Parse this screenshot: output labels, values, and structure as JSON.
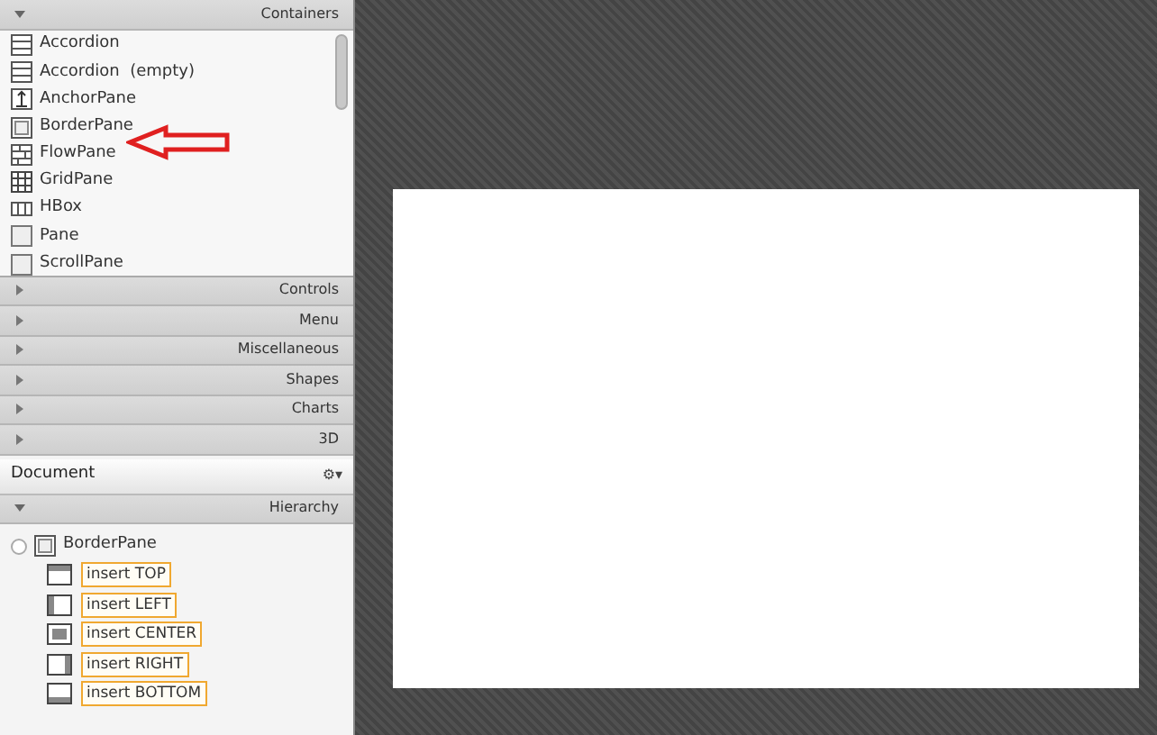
{
  "library": {
    "sections": [
      {
        "title": "Containers",
        "expanded": true,
        "items": [
          {
            "label": "Accordion",
            "kind": "accordion"
          },
          {
            "label": "Accordion  (empty)",
            "kind": "accordion"
          },
          {
            "label": "AnchorPane",
            "kind": "anchor"
          },
          {
            "label": "BorderPane",
            "kind": "border"
          },
          {
            "label": "FlowPane",
            "kind": "flow"
          },
          {
            "label": "GridPane",
            "kind": "grid"
          },
          {
            "label": "HBox",
            "kind": "hbox"
          },
          {
            "label": "Pane",
            "kind": "pane"
          },
          {
            "label": "ScrollPane",
            "kind": "pane"
          }
        ]
      },
      {
        "title": "Controls",
        "expanded": false
      },
      {
        "title": "Menu",
        "expanded": false
      },
      {
        "title": "Miscellaneous",
        "expanded": false
      },
      {
        "title": "Shapes",
        "expanded": false
      },
      {
        "title": "Charts",
        "expanded": false
      },
      {
        "title": "3D",
        "expanded": false
      }
    ]
  },
  "document": {
    "title": "Document",
    "menu_glyph": "⚙▾"
  },
  "hierarchy": {
    "title": "Hierarchy",
    "expanded": true,
    "tree": [
      {
        "label": "BorderPane",
        "expanded": true,
        "children": [
          {
            "label": "insert TOP",
            "kind": "top"
          },
          {
            "label": "insert LEFT",
            "kind": "left"
          },
          {
            "label": "insert CENTER",
            "kind": "center"
          },
          {
            "label": "insert RIGHT",
            "kind": "right"
          },
          {
            "label": "insert BOTTOM",
            "kind": "bottom"
          }
        ]
      }
    ]
  }
}
